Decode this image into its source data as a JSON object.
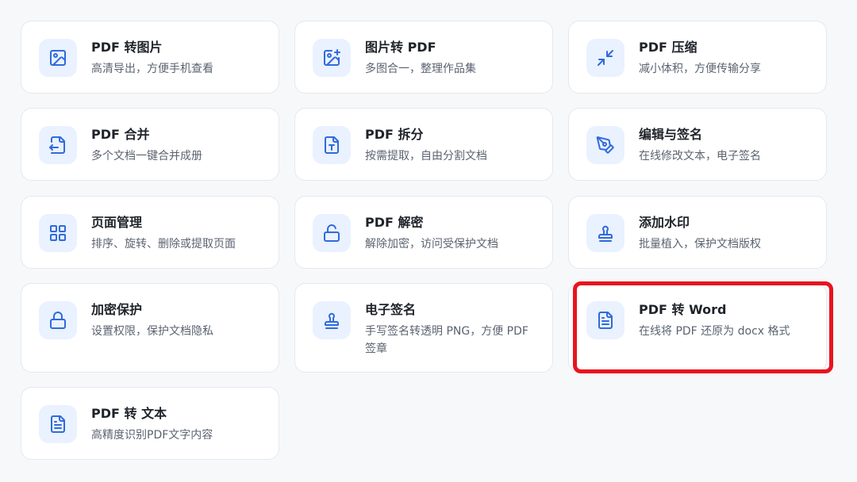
{
  "colors": {
    "accent": "#2f6bdc",
    "icon_bg": "#eaf1ff",
    "highlight": "#e8141e"
  },
  "tools": [
    {
      "title": "PDF 转图片",
      "desc": "高清导出，方便手机查看",
      "icon": "image-icon"
    },
    {
      "title": "图片转 PDF",
      "desc": "多图合一，整理作品集",
      "icon": "image-plus-icon"
    },
    {
      "title": "PDF 压缩",
      "desc": "减小体积，方便传输分享",
      "icon": "compress-arrows-icon"
    },
    {
      "title": "PDF 合并",
      "desc": "多个文档一键合并成册",
      "icon": "file-merge-icon"
    },
    {
      "title": "PDF 拆分",
      "desc": "按需提取，自由分割文档",
      "icon": "file-text-split-icon"
    },
    {
      "title": "编辑与签名",
      "desc": "在线修改文本，电子签名",
      "icon": "pen-tool-icon"
    },
    {
      "title": "页面管理",
      "desc": "排序、旋转、删除或提取页面",
      "icon": "grid-icon"
    },
    {
      "title": "PDF 解密",
      "desc": "解除加密，访问受保护文档",
      "icon": "unlock-icon"
    },
    {
      "title": "添加水印",
      "desc": "批量植入，保护文档版权",
      "icon": "stamp-icon"
    },
    {
      "title": "加密保护",
      "desc": "设置权限，保护文档隐私",
      "icon": "lock-icon"
    },
    {
      "title": "电子签名",
      "desc": "手写签名转透明 PNG，方便 PDF 签章",
      "icon": "stamp-icon"
    },
    {
      "title": "PDF 转 Word",
      "desc": "在线将 PDF 还原为 docx 格式",
      "icon": "file-document-icon"
    },
    {
      "title": "PDF 转 文本",
      "desc": "高精度识别PDF文字内容",
      "icon": "file-document-icon"
    }
  ]
}
